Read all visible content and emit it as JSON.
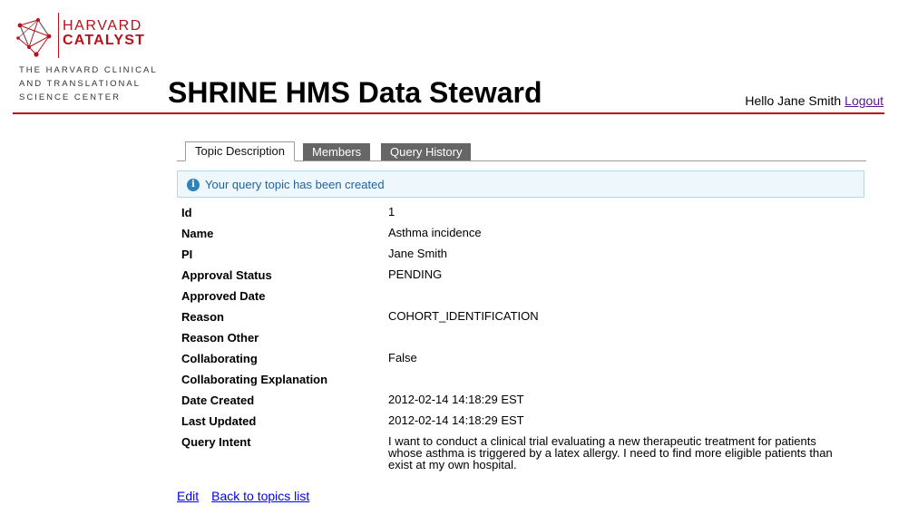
{
  "logo": {
    "word1": "HARVARD",
    "word2": "CATALYST",
    "tagline": [
      "THE HARVARD CLINICAL",
      "AND TRANSLATIONAL",
      "SCIENCE CENTER"
    ],
    "brand_color": "#b5121b"
  },
  "header": {
    "title": "SHRINE HMS Data Steward",
    "greeting": "Hello Jane Smith",
    "logout_label": "Logout"
  },
  "tabs": [
    {
      "label": "Topic Description",
      "active": true
    },
    {
      "label": "Members",
      "active": false
    },
    {
      "label": "Query History",
      "active": false
    }
  ],
  "notice": {
    "icon": "info-icon",
    "text": "Your query topic has been created"
  },
  "details": [
    {
      "label": "Id",
      "value": "1"
    },
    {
      "label": "Name",
      "value": "Asthma incidence"
    },
    {
      "label": "PI",
      "value": "Jane Smith"
    },
    {
      "label": "Approval Status",
      "value": "PENDING"
    },
    {
      "label": "Approved Date",
      "value": ""
    },
    {
      "label": "Reason",
      "value": "COHORT_IDENTIFICATION"
    },
    {
      "label": "Reason Other",
      "value": ""
    },
    {
      "label": "Collaborating",
      "value": "False"
    },
    {
      "label": "Collaborating Explanation",
      "value": ""
    },
    {
      "label": "Date Created",
      "value": "2012-02-14 14:18:29 EST"
    },
    {
      "label": "Last Updated",
      "value": "2012-02-14 14:18:29 EST"
    },
    {
      "label": "Query Intent",
      "value": "I want to conduct a clinical trial evaluating a new therapeutic treatment for patients whose asthma is triggered by a latex allergy. I need to find more eligible patients than exist at my own hospital."
    }
  ],
  "actions": {
    "edit_label": "Edit",
    "back_label": "Back to topics list"
  }
}
